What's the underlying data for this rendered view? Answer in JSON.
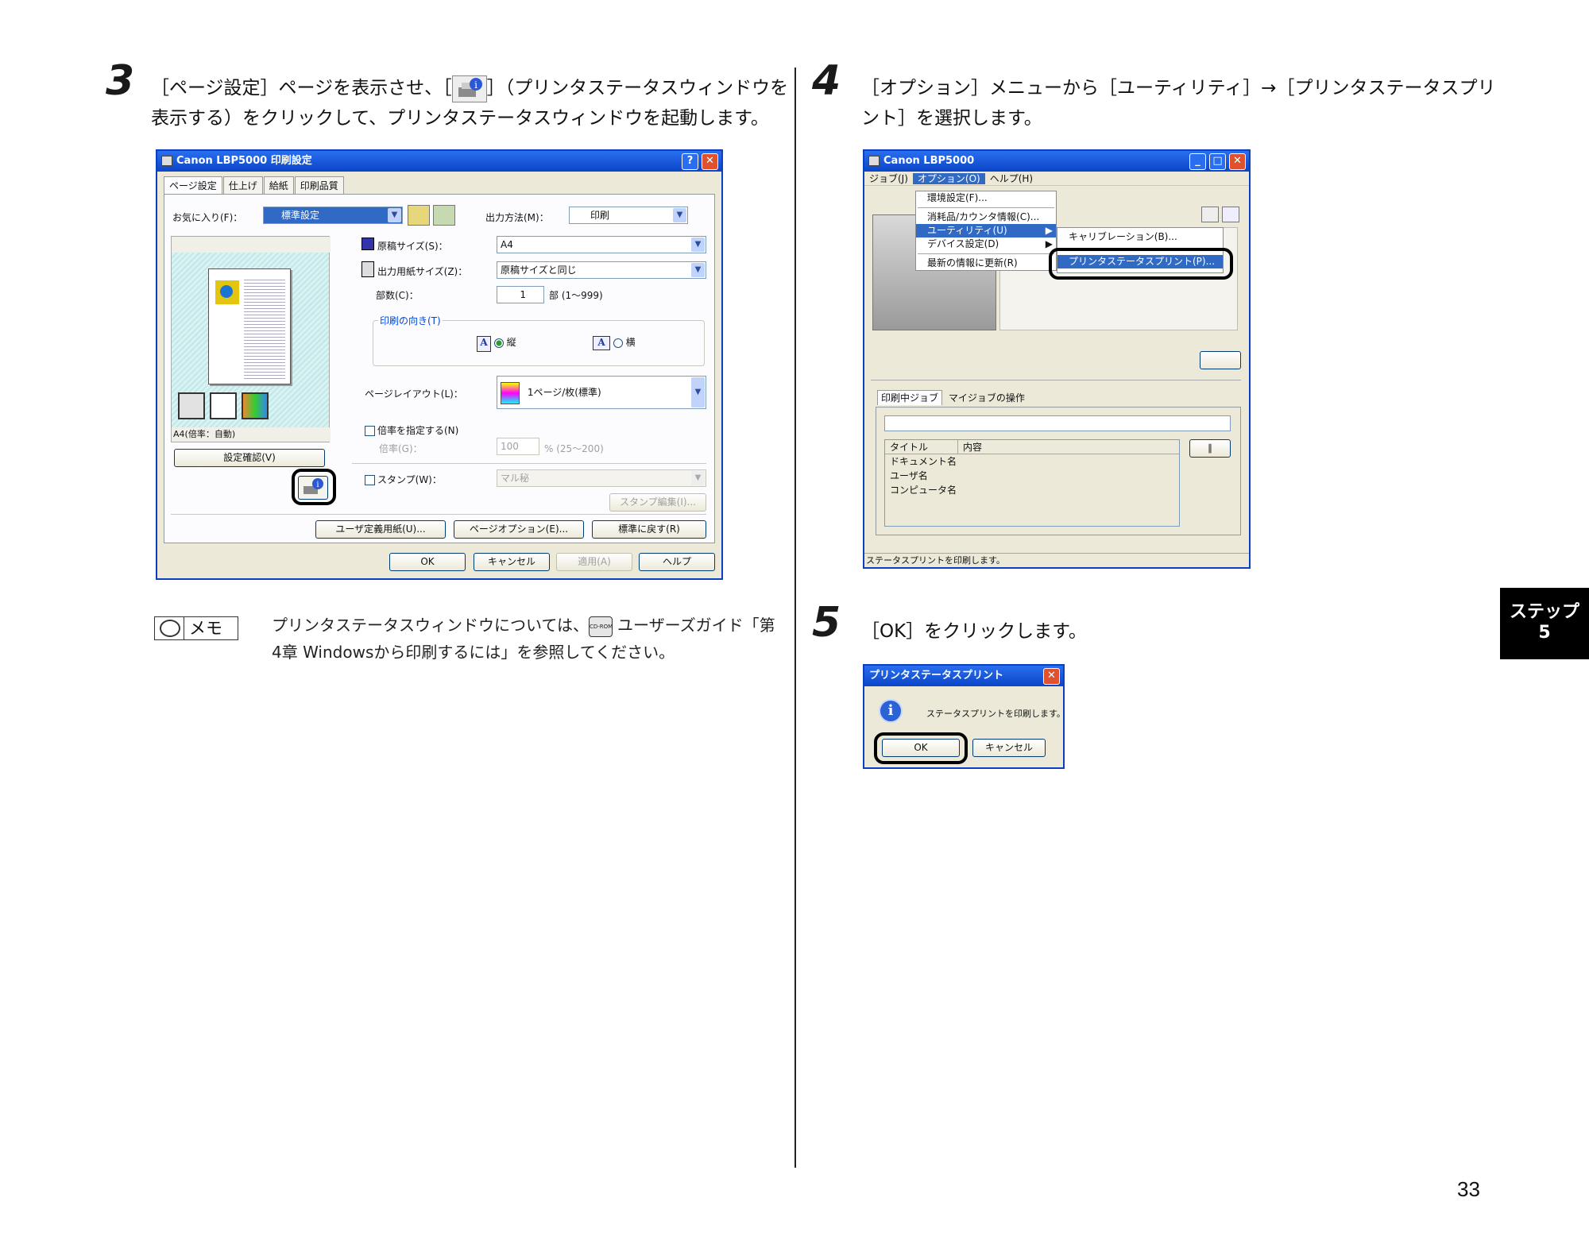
{
  "step3": {
    "number": "3",
    "text_line1": "［ページ設定］ページを表示させ、［",
    "text_line1b": "］（プリンタステータスウィンドウを",
    "text_line2": "表示する）をクリックして、プリンタステータスウィンドウを起動します。"
  },
  "dialog1": {
    "title": "Canon LBP5000 印刷設定",
    "tabs": [
      "ページ設定",
      "仕上げ",
      "給紙",
      "印刷品質"
    ],
    "favorites_label": "お気に入り(F)：",
    "favorites_value": "標準設定",
    "output_label": "出力方法(M)：",
    "output_value": "印刷",
    "paper_size_label": "原稿サイズ(S)：",
    "paper_size_value": "A4",
    "output_paper_label": "出力用紙サイズ(Z)：",
    "output_paper_value": "原稿サイズと同じ",
    "copies_label": "部数(C)：",
    "copies_value": "1",
    "copies_unit": "部 (1～999)",
    "orientation_group": "印刷の向き(T)",
    "portrait": "縦",
    "landscape": "横",
    "layout_label": "ページレイアウト(L)：",
    "layout_value": "1ページ/枚(標準)",
    "scale_check": "倍率を指定する(N)",
    "scale_label": "倍率(G)：",
    "scale_value": "100",
    "scale_range": "% (25～200)",
    "stamp_check": "スタンプ(W)：",
    "stamp_value": "マル秘",
    "stamp_edit": "スタンプ編集(I)...",
    "preview_caption": "A4(倍率：自動)",
    "confirm_button": "設定確認(V)",
    "btn_custom_paper": "ユーザ定義用紙(U)...",
    "btn_page_options": "ページオプション(E)...",
    "btn_defaults": "標準に戻す(R)",
    "btn_ok": "OK",
    "btn_cancel": "キャンセル",
    "btn_apply": "適用(A)",
    "btn_help": "ヘルプ"
  },
  "memo": {
    "label": "メモ",
    "text_line1a": "プリンタステータスウィンドウについては、",
    "text_line1b": "ユーザーズガイド「第",
    "text_line2": "4章 Windowsから印刷するには」を参照してください。",
    "cdrom_icon_label": "CD-ROM"
  },
  "step4": {
    "number": "4",
    "text_line1": "［オプション］メニューから［ユーティリティ］→［プリンタステータスプリ",
    "text_line2": "ント］を選択します。"
  },
  "window2": {
    "title": "Canon LBP5000",
    "menubar": [
      "ジョブ(J)",
      "オプション(O)",
      "ヘルプ(H)"
    ],
    "options_menu": [
      "環境設定(F)...",
      "消耗品/カウンタ情報(C)...",
      "ユーティリティ(U)",
      "デバイス設定(D)",
      "最新の情報に更新(R)"
    ],
    "utility_submenu": [
      "キャリブレーション(B)...",
      "プリンタステータスプリント(P)..."
    ],
    "tabs": [
      "印刷中ジョブ",
      "マイジョブの操作"
    ],
    "job_headers": [
      "タイトル",
      "内容"
    ],
    "job_rows": [
      "ドキュメント名",
      "ユーザ名",
      "コンピュータ名"
    ],
    "statusbar": "ステータスプリントを印刷します。"
  },
  "step5": {
    "number": "5",
    "text": "［OK］をクリックします。"
  },
  "dialog3": {
    "title": "プリンタステータスプリント",
    "message": "ステータスプリントを印刷します。",
    "btn_ok": "OK",
    "btn_cancel": "キャンセル"
  },
  "side_tab": {
    "line1": "ステップ",
    "line2": "5"
  },
  "page_number": "33"
}
